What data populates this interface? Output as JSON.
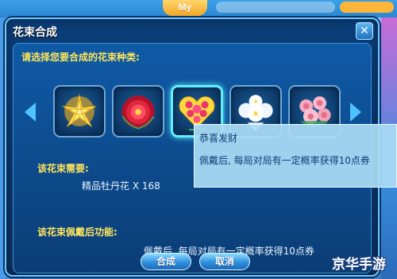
{
  "background": {
    "logo": "My",
    "level_text": "",
    "score_text": ""
  },
  "dialog": {
    "title": "花束合成",
    "close_glyph": "✕",
    "prompt": "请选择您要合成的花束种类:",
    "bouquets": [
      {
        "icon": "golden-flower-icon",
        "selected": false
      },
      {
        "icon": "red-peony-icon",
        "selected": false
      },
      {
        "icon": "heart-rose-bouquet-icon",
        "selected": true
      },
      {
        "icon": "white-flower-bouquet-icon",
        "selected": false
      },
      {
        "icon": "pink-rose-bouquet-icon",
        "selected": false
      }
    ],
    "requirement_label": "该花束需要:",
    "requirement_item": "精品牡丹花  X 168",
    "function_label": "该花束佩戴后功能:",
    "function_text": "佩戴后, 每局对局有一定概率获得10点券",
    "tooltip": {
      "title": "恭喜发财",
      "body": "佩戴后, 每局对局有一定概率获得10点券"
    },
    "buttons": {
      "confirm": "合成",
      "cancel": "取消"
    }
  },
  "watermark": "京华手游",
  "colors": {
    "accent_text": "#ffe65c",
    "selected_border": "#5ff0ff",
    "panel": "#0f5aa6"
  }
}
